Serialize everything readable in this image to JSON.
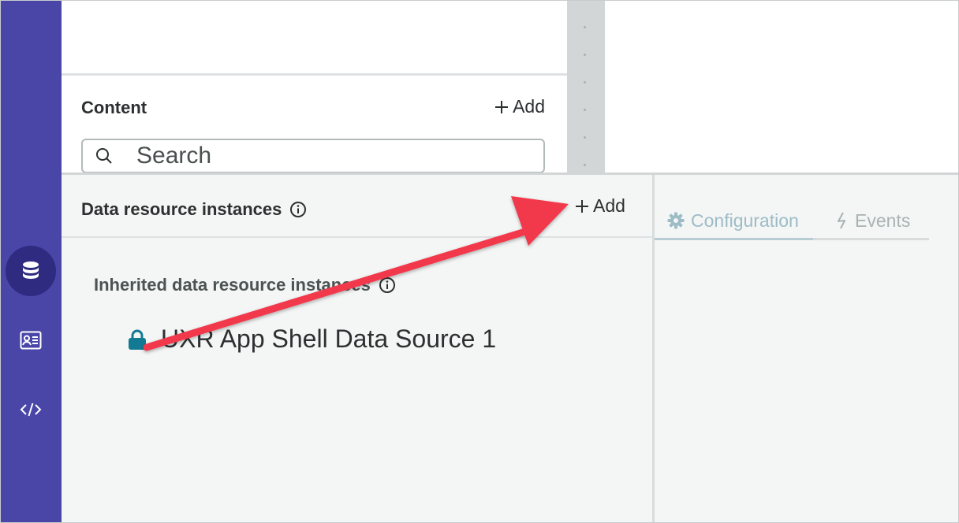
{
  "rail": {
    "items": [
      {
        "icon": "database-icon",
        "active": true
      },
      {
        "icon": "contact-card-icon",
        "active": false
      },
      {
        "icon": "code-icon",
        "active": false
      }
    ]
  },
  "content": {
    "title": "Content",
    "add_label": "Add",
    "search_placeholder": "Search"
  },
  "data_resources": {
    "title": "Data resource instances",
    "add_label": "Add",
    "inherited_title": "Inherited data resource instances",
    "instances": [
      {
        "name": "UXR App Shell Data Source 1",
        "icon": "lock-icon"
      }
    ]
  },
  "right_panel": {
    "tabs": [
      {
        "label": "Configuration",
        "icon": "gear-icon",
        "active": true
      },
      {
        "label": "Events",
        "icon": "lightning-icon",
        "active": false
      }
    ]
  },
  "annotation": {
    "type": "arrow",
    "color": "#f2374b"
  },
  "colors": {
    "rail": "#4a46a8",
    "rail_active": "#2e2b80",
    "lock": "#127a93",
    "accent_arrow": "#f2374b"
  }
}
